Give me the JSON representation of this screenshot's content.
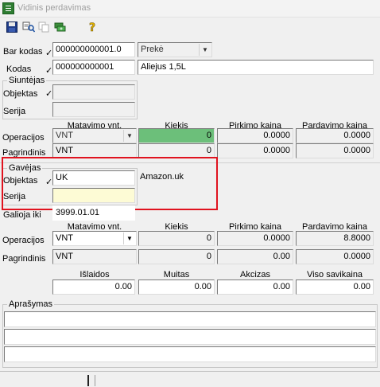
{
  "window": {
    "title": "Vidinis perdavimas"
  },
  "toolbar": {
    "items": [
      "save-icon",
      "search-icon",
      "copy-icon",
      "money-icon",
      "help-icon"
    ]
  },
  "header": {
    "bar_kodas_label": "Bar kodas",
    "bar_kodas_value": "000000000001.0",
    "type_value": "Prekė",
    "kodas_label": "Kodas",
    "kodas_value": "000000000001",
    "product_name": "Aliejus 1,5L"
  },
  "siuntejas": {
    "title": "Siuntėjas",
    "objektas_label": "Objektas",
    "objektas_value": "",
    "serija_label": "Serija",
    "serija_value": "",
    "columns": [
      "Matavimo vnt.",
      "Kiekis",
      "Pirkimo kaina",
      "Pardavimo kaina"
    ],
    "rows": [
      {
        "label": "Operacijos",
        "unit": "VNT",
        "kiekis": "0",
        "pirkimo": "0.0000",
        "pardavimo": "0.0000"
      },
      {
        "label": "Pagrindinis",
        "unit": "VNT",
        "kiekis": "0",
        "pirkimo": "0.0000",
        "pardavimo": "0.0000"
      }
    ]
  },
  "gavejas": {
    "title": "Gavėjas",
    "objektas_label": "Objektas",
    "objektas_value": "UK",
    "objektas_name": "Amazon.uk",
    "serija_label": "Serija",
    "serija_value": "",
    "galioja_label": "Galioja iki",
    "galioja_value": "3999.01.01",
    "columns": [
      "Matavimo vnt.",
      "Kiekis",
      "Pirkimo kaina",
      "Pardavimo kaina"
    ],
    "rows": [
      {
        "label": "Operacijos",
        "unit": "VNT",
        "kiekis": "0",
        "pirkimo": "0.0000",
        "pardavimo": "8.8000"
      },
      {
        "label": "Pagrindinis",
        "unit": "VNT",
        "kiekis": "0",
        "pirkimo": "0.00",
        "pardavimo": "0.0000"
      }
    ]
  },
  "costs": {
    "labels": [
      "Išlaidos",
      "Muitas",
      "Akcizas",
      "Viso savikaina"
    ],
    "values": [
      "0.00",
      "0.00",
      "0.00",
      "0.00"
    ]
  },
  "aprasymas": {
    "title": "Aprašymas",
    "lines": [
      "",
      "",
      ""
    ]
  },
  "colors": {
    "highlight": "#e0131f",
    "green": "#6cbf7a",
    "yellow": "#fdfbd5"
  }
}
